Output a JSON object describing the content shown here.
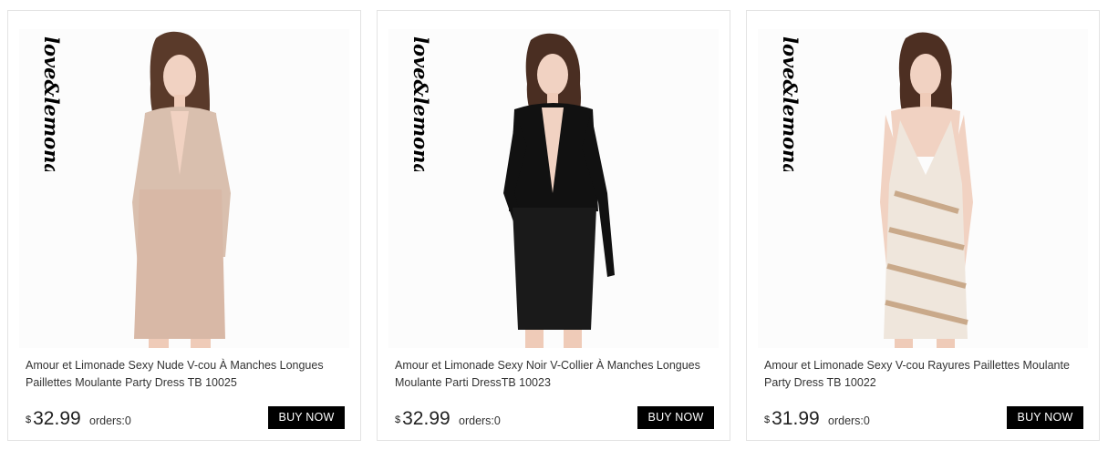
{
  "products": [
    {
      "brand": "love&lemonade",
      "title": "Amour et Limonade Sexy Nude V-cou À Manches Longues Paillettes Moulante Party Dress TB 10025",
      "currency": "$",
      "price": "32.99",
      "orders": "orders:0",
      "button": "BUY NOW",
      "dress_top_color": "#d9bfae",
      "dress_skirt_color": "#d8b8a6"
    },
    {
      "brand": "love&lemonade",
      "title": "Amour et Limonade Sexy Noir V-Collier À Manches Longues Moulante Parti DressTB 10023",
      "currency": "$",
      "price": "32.99",
      "orders": "orders:0",
      "button": "BUY NOW",
      "dress_top_color": "#111111",
      "dress_skirt_color": "#1a1a1a"
    },
    {
      "brand": "love&lemonade",
      "title": "Amour et Limonade Sexy V-cou Rayures Paillettes Moulante Party Dress TB 10022",
      "currency": "$",
      "price": "31.99",
      "orders": "orders:0",
      "button": "BUY NOW",
      "dress_top_color": "#efe6dc",
      "dress_skirt_color": "#e8dccd"
    }
  ]
}
